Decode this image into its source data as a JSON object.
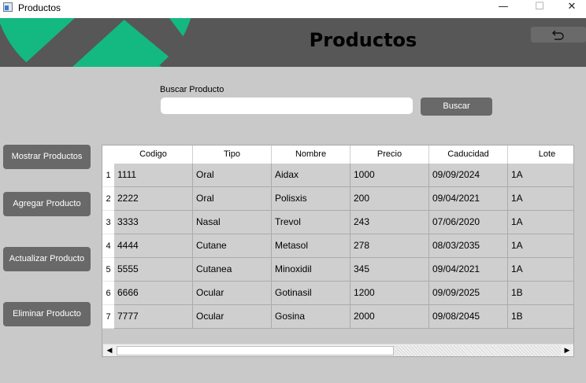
{
  "window": {
    "title": "Productos",
    "minimize": "—",
    "maximize": "☐",
    "close": "✕"
  },
  "header": {
    "title": "Productos",
    "accent_color": "#13b981",
    "back_icon": "undo-icon"
  },
  "search": {
    "label": "Buscar Producto",
    "value": "",
    "placeholder": "",
    "button": "Buscar"
  },
  "sidebar": {
    "show": "Mostrar Productos",
    "add": "Agregar Producto",
    "update": "Actualizar Producto",
    "delete": "Eliminar Producto"
  },
  "table": {
    "columns": [
      "Codigo",
      "Tipo",
      "Nombre",
      "Precio",
      "Caducidad",
      "Lote"
    ],
    "rows": [
      {
        "n": "1",
        "cells": [
          "1111",
          "Oral",
          "Aidax",
          "1000",
          "09/09/2024",
          "1A"
        ]
      },
      {
        "n": "2",
        "cells": [
          "2222",
          "Oral",
          "Polisxis",
          "200",
          "09/04/2021",
          "1A"
        ]
      },
      {
        "n": "3",
        "cells": [
          "3333",
          "Nasal",
          "Trevol",
          "243",
          "07/06/2020",
          "1A"
        ]
      },
      {
        "n": "4",
        "cells": [
          "4444",
          "Cutane",
          "Metasol",
          "278",
          "08/03/2035",
          "1A"
        ]
      },
      {
        "n": "5",
        "cells": [
          "5555",
          "Cutanea",
          "Minoxidil",
          "345",
          "09/04/2021",
          "1A"
        ]
      },
      {
        "n": "6",
        "cells": [
          "6666",
          "Ocular",
          "Gotinasil",
          "1200",
          "09/09/2025",
          "1B"
        ]
      },
      {
        "n": "7",
        "cells": [
          "7777",
          "Ocular",
          "Gosina",
          "2000",
          "09/08/2045",
          "1B"
        ]
      }
    ],
    "scroll_left": "◀",
    "scroll_right": "▶"
  }
}
